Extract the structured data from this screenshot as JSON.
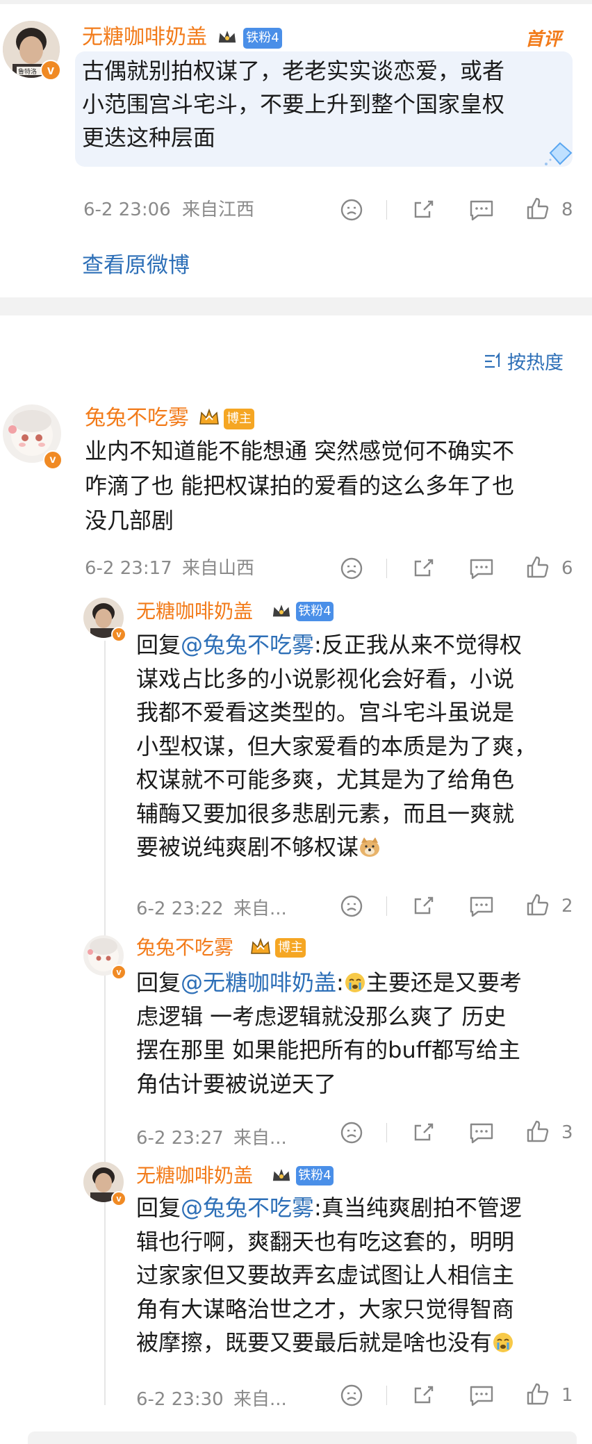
{
  "top_comment": {
    "user": "无糖咖啡奶盖",
    "fan_badge": "铁粉4",
    "tag": "首评",
    "avatar_text": "鲁特洛",
    "text": [
      "古偶就别拍权谋了，老老实实谈恋爱，或者",
      "小范围宫斗宅斗，不要上升到整个国家皇权",
      "更迭这种层面"
    ],
    "time": "6-2 23:06",
    "location": "来自江西",
    "likes": "8",
    "view_original": "查看原微博"
  },
  "sort": {
    "label": "按热度"
  },
  "comment": {
    "user": "兔兔不吃雾",
    "role_badge": "博主",
    "text": [
      "业内不知道能不能想通 突然感觉何不确实不",
      "咋滴了也 能把权谋拍的爱看的这么多年了也",
      "没几部剧"
    ],
    "time": "6-2 23:17",
    "location": "来自山西",
    "likes": "6"
  },
  "replies": [
    {
      "user": "无糖咖啡奶盖",
      "badge": "铁粉4",
      "reply_prefix": "回复",
      "at": "@兔兔不吃雾",
      "lines": [
        ":反正我从来不觉得权",
        "谋戏占比多的小说影视化会好看，小说",
        "我都不爱看这类型的。宫斗宅斗虽说是",
        "小型权谋，但大家爱看的本质是为了爽，",
        "权谋就不可能多爽，尤其是为了给角色",
        "辅酶又要加很多悲剧元素，而且一爽就",
        "要被说纯爽剧不够权谋"
      ],
      "emoji": "doge",
      "time": "6-2 23:22",
      "location": "来自...",
      "likes": "2"
    },
    {
      "user": "兔兔不吃雾",
      "badge": "博主",
      "reply_prefix": "回复",
      "at": "@无糖咖啡奶盖",
      "lines": [
        ":",
        "主要还是又要考",
        "虑逻辑 一考虑逻辑就没那么爽了 历史",
        "摆在那里 如果能把所有的buff都写给主",
        "角估计要被说逆天了"
      ],
      "emoji": "crying",
      "time": "6-2 23:27",
      "location": "来自...",
      "likes": "3"
    },
    {
      "user": "无糖咖啡奶盖",
      "badge": "铁粉4",
      "reply_prefix": "回复",
      "at": "@兔兔不吃雾",
      "lines": [
        ":真当纯爽剧拍不管逻",
        "辑也行啊，爽翻天也有吃这套的，明明",
        "过家家但又要故弄玄虚试图让人相信主",
        "角有大谋略治世之才，大家只觉得智商",
        "被摩擦，既要又要最后就是啥也没有"
      ],
      "emoji": "crying",
      "time": "6-2 23:30",
      "location": "来自...",
      "likes": "1"
    }
  ],
  "colors": {
    "username": "#f27b1a",
    "link": "#2d6fb7",
    "fan_badge": "#4a8fe8",
    "role_badge": "#f5a623",
    "meta": "#8a8a8a"
  }
}
